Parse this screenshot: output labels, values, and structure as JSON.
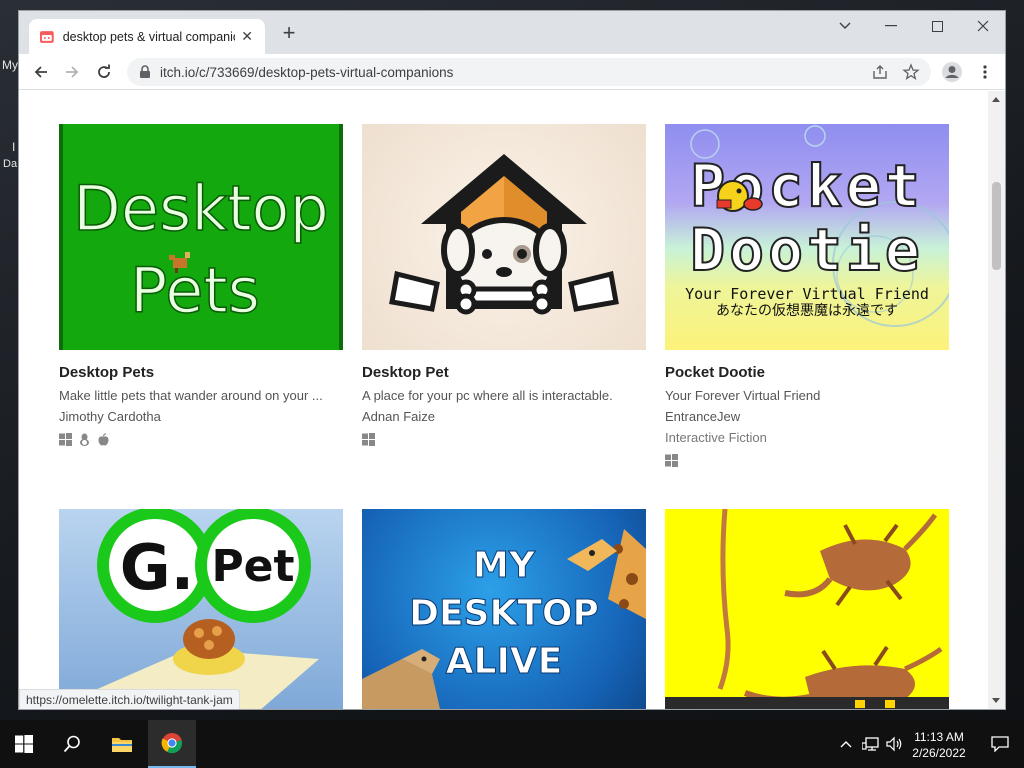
{
  "desktop": {
    "label_1": "My",
    "label_2": "I",
    "label_3": "Da"
  },
  "browser": {
    "tab_title": "desktop pets & virtual companio",
    "url": "itch.io/c/733669/desktop-pets-virtual-companions",
    "status_url": "https://omelette.itch.io/twilight-tank-jam"
  },
  "games": [
    {
      "title": "Desktop Pets",
      "desc": "Make little pets that wander around on your ...",
      "author": "Jimothy Cardotha",
      "genre": "",
      "platforms": [
        "windows-icon",
        "linux-icon",
        "apple-icon"
      ]
    },
    {
      "title": "Desktop Pet",
      "desc": "A place for your pc where all is interactable.",
      "author": "Adnan Faize",
      "genre": "",
      "platforms": [
        "windows-icon"
      ]
    },
    {
      "title": "Pocket Dootie",
      "desc": "Your Forever Virtual Friend",
      "author": "EntranceJew",
      "genre": "Interactive Fiction",
      "platforms": [
        "windows-icon"
      ]
    }
  ],
  "thumbs": {
    "desktop_pets": {
      "line1": "Desktop",
      "line2": "Pets"
    },
    "pocket_dootie": {
      "line1": "Pocket",
      "line2": "Dootie",
      "line3": "Your Forever Virtual Friend",
      "line4": "あなたの仮想悪魔は永遠です"
    },
    "gpet": {
      "g": "G.",
      "pet": "Pet"
    },
    "my_desktop_alive": {
      "line1": "MY",
      "line2": "DESKTOP",
      "line3": "ALIVE"
    }
  },
  "taskbar": {
    "time": "11:13 AM",
    "date": "2/26/2022"
  },
  "colors": {
    "tab_strip": "#dee1e6",
    "itch_red": "#fa5c5c",
    "green_thumb": "#12a80e"
  }
}
